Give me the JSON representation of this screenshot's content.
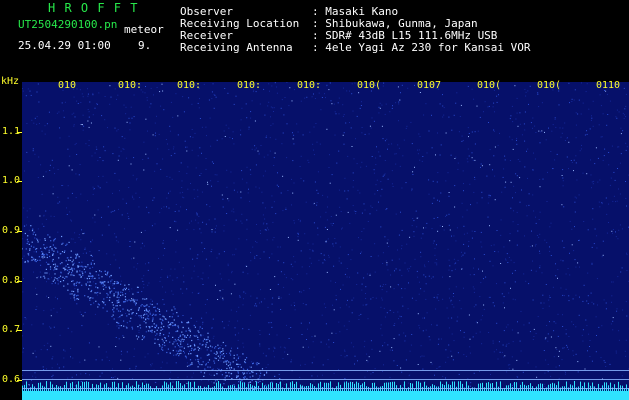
{
  "header": {
    "app_title": "H R O F F T",
    "file_name": "UT2504290100.pn",
    "mode": "meteor",
    "datetime": "25.04.29 01:00",
    "count": "9.",
    "info_labels": [
      "Observer",
      "Receiving Location",
      "Receiver",
      "Receiving Antenna"
    ],
    "info_values": [
      ": Masaki Kano",
      ": Shibukawa, Gunma, Japan",
      ": SDR# 43dB L15 111.6MHz USB",
      ": 4ele Yagi Az 230 for Kansai VOR"
    ]
  },
  "axis": {
    "unit": "kHz",
    "y_labels": [
      "1.1",
      "1.0",
      "0.9",
      "0.8",
      "0.7",
      "0.6"
    ],
    "x_labels": [
      "010",
      "010:",
      "010:",
      "010:",
      "010:",
      "010(",
      "0107",
      "010(",
      "010(",
      "0110"
    ]
  },
  "colors": {
    "background": "#000000",
    "spectrum": "#06106a",
    "trace": "#2fe3ff",
    "axis": "#ffff2a",
    "title": "#27e84a"
  }
}
